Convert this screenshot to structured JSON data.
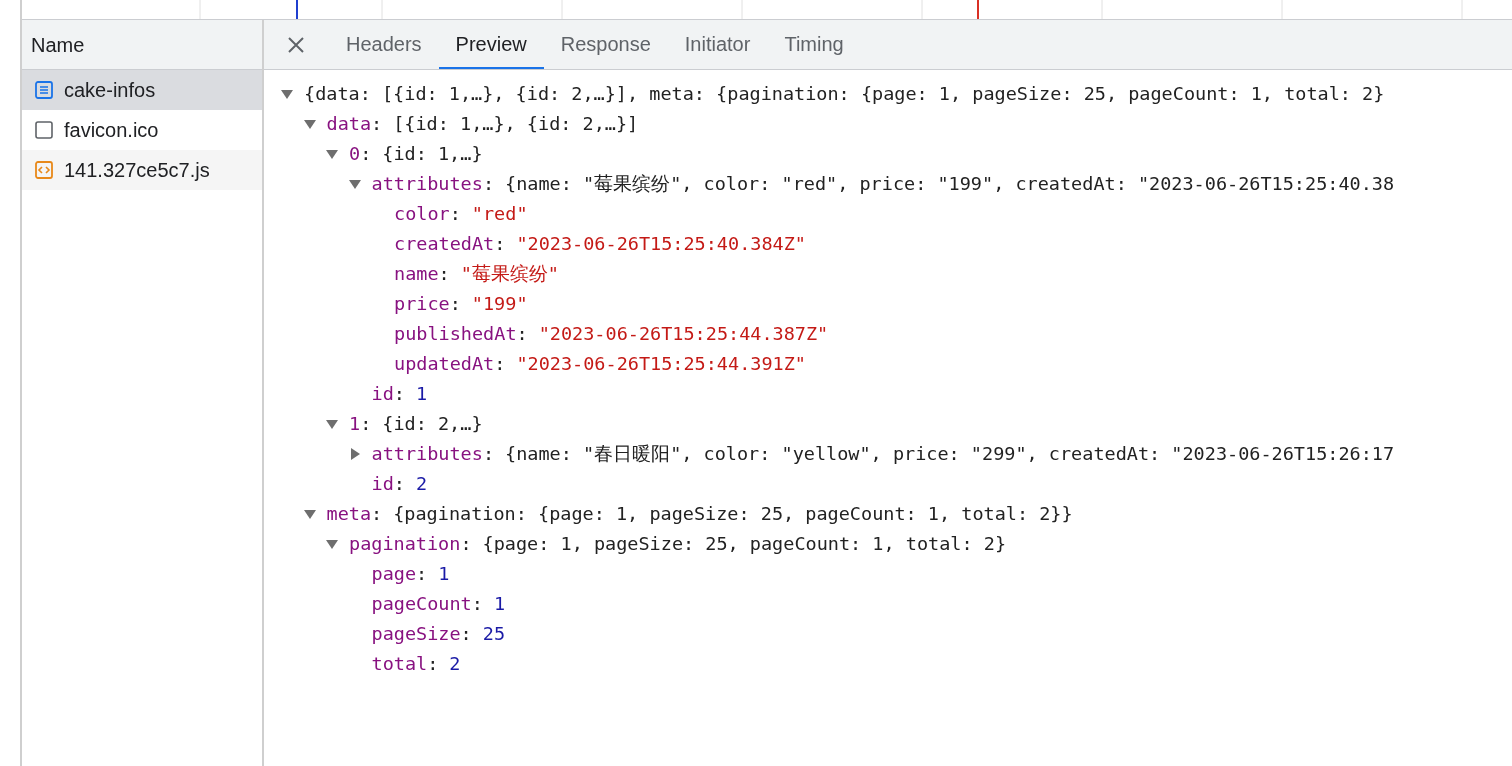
{
  "requests": {
    "column_header": "Name",
    "items": [
      {
        "name": "cake-infos",
        "kind": "document",
        "selected": true
      },
      {
        "name": "favicon.ico",
        "kind": "other",
        "selected": false
      },
      {
        "name": "141.327ce5c7.js",
        "kind": "script",
        "selected": false
      }
    ]
  },
  "tabs": [
    {
      "label": "Headers",
      "selected": false
    },
    {
      "label": "Preview",
      "selected": true
    },
    {
      "label": "Response",
      "selected": false
    },
    {
      "label": "Initiator",
      "selected": false
    },
    {
      "label": "Timing",
      "selected": false
    }
  ],
  "preview": {
    "summary": "{data: [{id: 1,…}, {id: 2,…}], meta: {pagination: {page: 1, pageSize: 25, pageCount: 1, total: 2}",
    "kind": "object",
    "expanded": true,
    "children": [
      {
        "key": "data:",
        "kind": "object",
        "summary": "[{id: 1,…}, {id: 2,…}]",
        "expanded": true,
        "children": [
          {
            "key": "0:",
            "kind": "object",
            "summary": "{id: 1,…}",
            "expanded": true,
            "children": [
              {
                "key": "attributes:",
                "kind": "object",
                "summary": "{name: \"莓果缤纷\", color: \"red\", price: \"199\", createdAt: \"2023-06-26T15:25:40.38",
                "expanded": true,
                "children": [
                  {
                    "key": "color:",
                    "kind": "string",
                    "value": "\"red\""
                  },
                  {
                    "key": "createdAt:",
                    "kind": "string",
                    "value": "\"2023-06-26T15:25:40.384Z\""
                  },
                  {
                    "key": "name:",
                    "kind": "string",
                    "value": "\"莓果缤纷\""
                  },
                  {
                    "key": "price:",
                    "kind": "string",
                    "value": "\"199\""
                  },
                  {
                    "key": "publishedAt:",
                    "kind": "string",
                    "value": "\"2023-06-26T15:25:44.387Z\""
                  },
                  {
                    "key": "updatedAt:",
                    "kind": "string",
                    "value": "\"2023-06-26T15:25:44.391Z\""
                  }
                ]
              },
              {
                "key": "id:",
                "kind": "number",
                "value": "1"
              }
            ]
          },
          {
            "key": "1:",
            "kind": "object",
            "summary": "{id: 2,…}",
            "expanded": true,
            "children": [
              {
                "key": "attributes:",
                "kind": "object",
                "summary": "{name: \"春日暖阳\", color: \"yellow\", price: \"299\", createdAt: \"2023-06-26T15:26:17",
                "expanded": false
              },
              {
                "key": "id:",
                "kind": "number",
                "value": "2"
              }
            ]
          }
        ]
      },
      {
        "key": "meta:",
        "kind": "object",
        "summary": "{pagination: {page: 1, pageSize: 25, pageCount: 1, total: 2}}",
        "expanded": true,
        "children": [
          {
            "key": "pagination:",
            "kind": "object",
            "summary": "{page: 1, pageSize: 25, pageCount: 1, total: 2}",
            "expanded": true,
            "children": [
              {
                "key": "page:",
                "kind": "number",
                "value": "1"
              },
              {
                "key": "pageCount:",
                "kind": "number",
                "value": "1"
              },
              {
                "key": "pageSize:",
                "kind": "number",
                "value": "25"
              },
              {
                "key": "total:",
                "kind": "number",
                "value": "2"
              }
            ]
          }
        ]
      }
    ]
  }
}
